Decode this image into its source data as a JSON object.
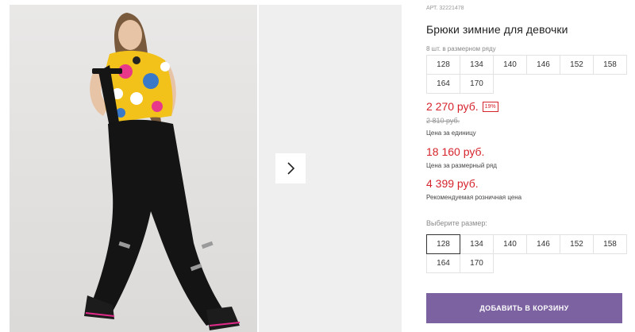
{
  "product": {
    "article": "АРТ. 32221478",
    "title": "Брюки зимние для девочки",
    "size_note": "8 шт. в размерном ряду",
    "sizes_row": [
      "128",
      "134",
      "140",
      "146",
      "152",
      "158",
      "164",
      "170"
    ],
    "price": "2 270 руб.",
    "discount": "19%",
    "old_price": "2 810 руб.",
    "unit_price_label": "Цена за единицу",
    "series_price": "18 160 руб.",
    "series_price_label": "Цена за размерный ряд",
    "retail_price": "4 399 руб.",
    "retail_price_label": "Рекомендуемая розничная цена",
    "choose_size_label": "Выберите размер:",
    "selected_size": "128",
    "add_to_cart": "ДОБАВИТЬ В КОРЗИНУ"
  },
  "colors": {
    "accent_purple": "#7c62a0",
    "price_red": "#d5242c"
  },
  "icons": {
    "next": "chevron-right-icon"
  }
}
